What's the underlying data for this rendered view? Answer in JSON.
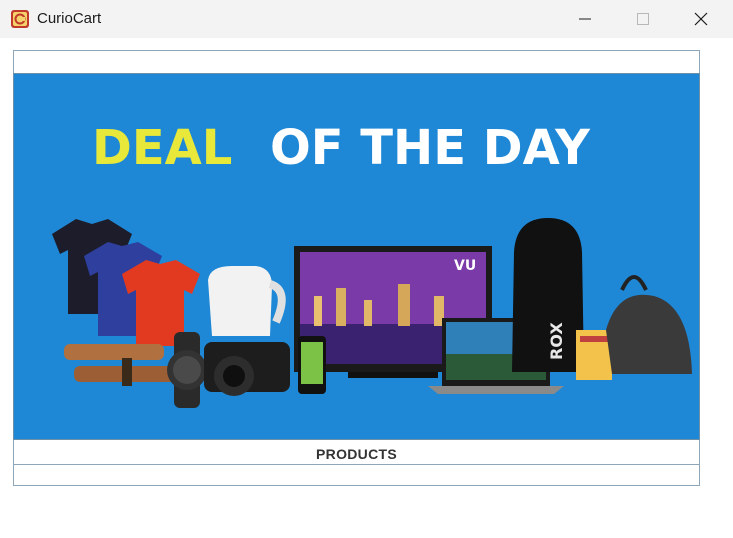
{
  "window": {
    "title": "CurioCart",
    "icon": "app-cart-icon",
    "controls": [
      "minimize-icon",
      "maximize-icon",
      "close-icon"
    ]
  },
  "banner": {
    "headline_part1": "DEAL",
    "headline_part2": "OF THE DAY",
    "tv_brand": "VU",
    "bag_brand": "ROX",
    "colors": {
      "background": "#1e88d6",
      "headline_accent": "#e8e83a",
      "headline_main": "#ffffff"
    }
  },
  "section": {
    "label": "PRODUCTS"
  }
}
